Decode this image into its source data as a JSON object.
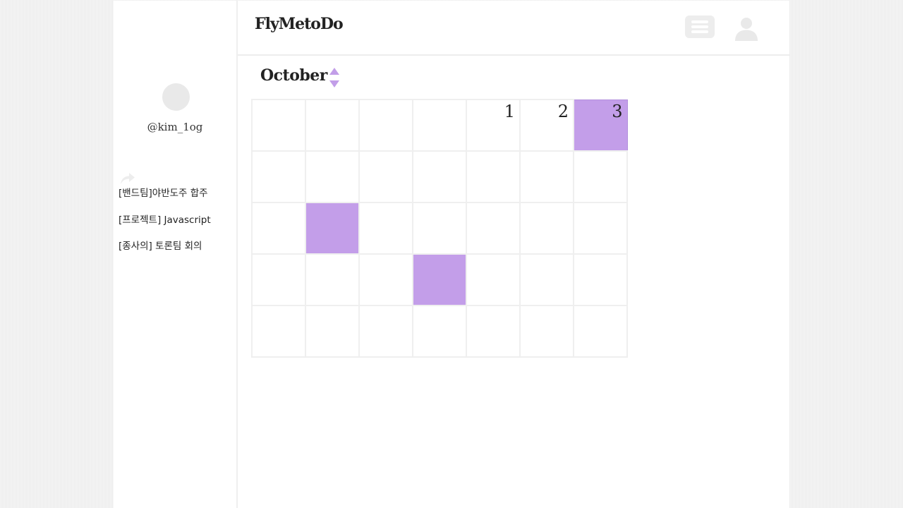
{
  "app": {
    "brand": "FlyMetoDo"
  },
  "profile": {
    "username": "@kim_1og"
  },
  "sidebar": {
    "share_icon": "share-arrow-icon",
    "posts": [
      {
        "label": "[밴드팀]야반도주 합주"
      },
      {
        "label": "[프로젝트] Javascript"
      },
      {
        "label": "[종사의] 토론팀 회의"
      }
    ]
  },
  "header": {
    "menu_icon": "list-menu-icon",
    "profile_icon": "user-profile-icon"
  },
  "calendar": {
    "month": "October",
    "highlight_color": "#c39ee9",
    "weeks": [
      [
        {
          "day": "",
          "marked": false
        },
        {
          "day": "",
          "marked": false
        },
        {
          "day": "",
          "marked": false
        },
        {
          "day": "",
          "marked": false
        },
        {
          "day": "1",
          "marked": false
        },
        {
          "day": "2",
          "marked": false
        },
        {
          "day": "3",
          "marked": true
        }
      ],
      [
        {
          "day": "",
          "marked": false
        },
        {
          "day": "",
          "marked": false
        },
        {
          "day": "",
          "marked": false
        },
        {
          "day": "",
          "marked": false
        },
        {
          "day": "",
          "marked": false
        },
        {
          "day": "",
          "marked": false
        },
        {
          "day": "",
          "marked": false
        }
      ],
      [
        {
          "day": "",
          "marked": false
        },
        {
          "day": "",
          "marked": true
        },
        {
          "day": "",
          "marked": false
        },
        {
          "day": "",
          "marked": false
        },
        {
          "day": "",
          "marked": false
        },
        {
          "day": "",
          "marked": false
        },
        {
          "day": "",
          "marked": false
        }
      ],
      [
        {
          "day": "",
          "marked": false
        },
        {
          "day": "",
          "marked": false
        },
        {
          "day": "",
          "marked": false
        },
        {
          "day": "",
          "marked": true
        },
        {
          "day": "",
          "marked": false
        },
        {
          "day": "",
          "marked": false
        },
        {
          "day": "",
          "marked": false
        }
      ],
      [
        {
          "day": "",
          "marked": false
        },
        {
          "day": "",
          "marked": false
        },
        {
          "day": "",
          "marked": false
        },
        {
          "day": "",
          "marked": false
        },
        {
          "day": "",
          "marked": false
        },
        {
          "day": "",
          "marked": false
        },
        {
          "day": "",
          "marked": false
        }
      ]
    ]
  }
}
